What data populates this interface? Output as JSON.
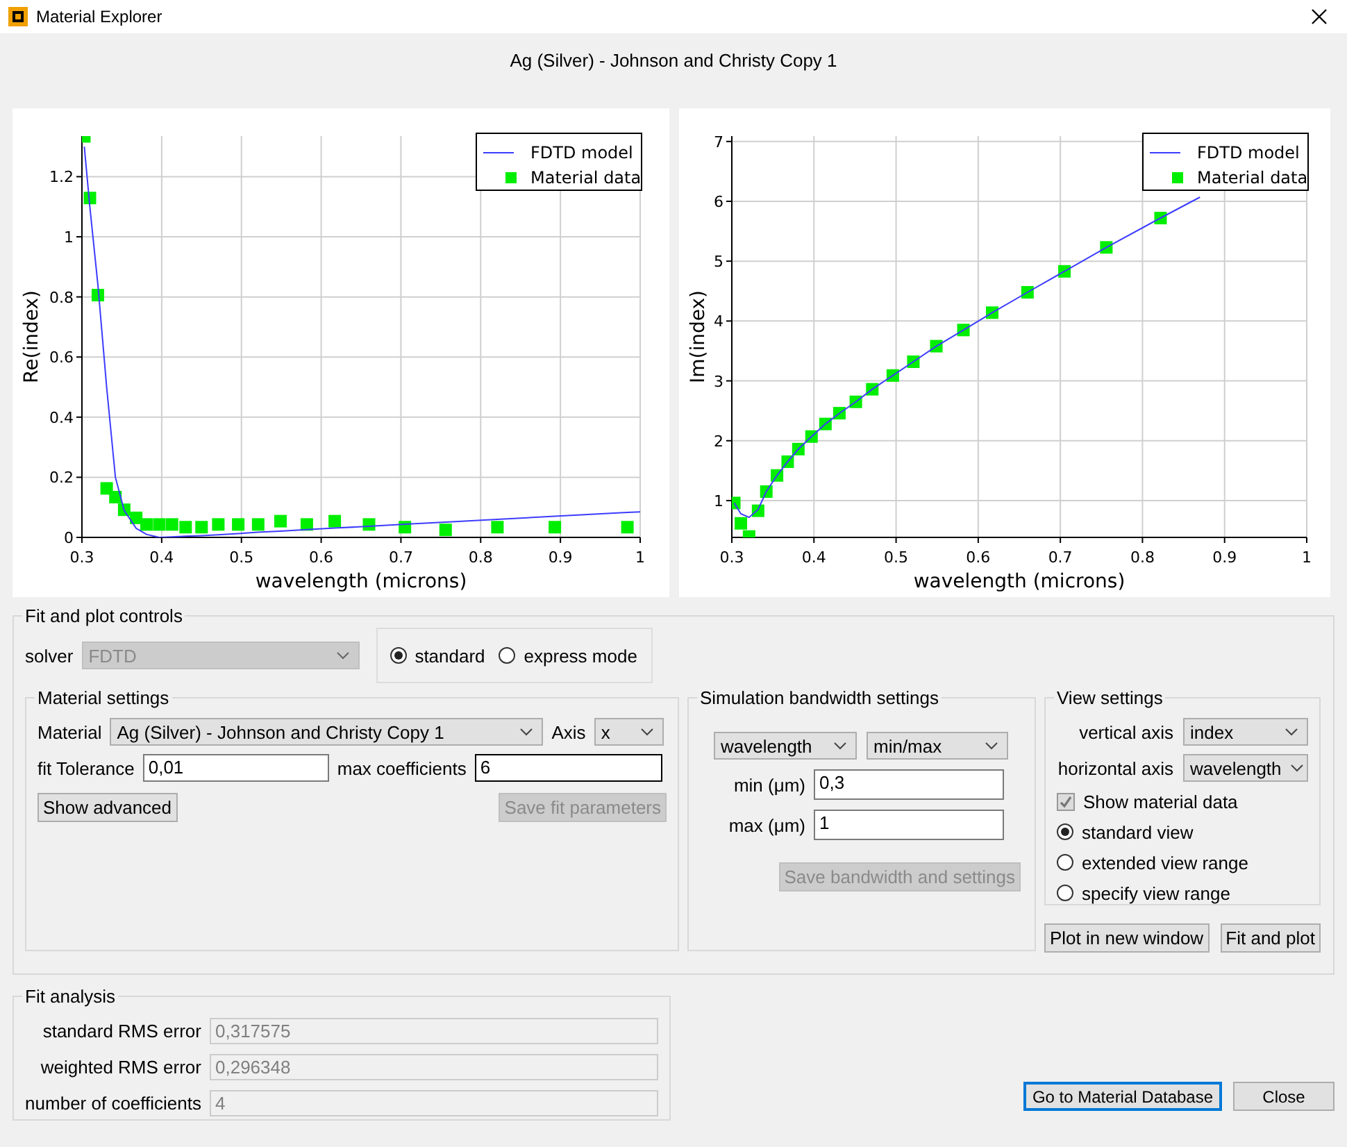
{
  "window": {
    "title": "Material Explorer"
  },
  "heading": "Ag (Silver) - Johnson and Christy Copy 1",
  "plots": [
    {
      "chart_data": {
        "type": "line",
        "xlabel": "wavelength (microns)",
        "ylabel": "Re(index)",
        "x": [
          0.303,
          0.31,
          0.32,
          0.331,
          0.342,
          0.353,
          0.368,
          0.381,
          0.397,
          0.413,
          0.43,
          0.45,
          0.471,
          0.496,
          0.521,
          0.549,
          0.582,
          0.617,
          0.66,
          0.705,
          0.756,
          0.821,
          0.893,
          0.984,
          1
        ],
        "xlim": [
          0.3,
          1
        ],
        "ylim": [
          0,
          1.335
        ],
        "grid": true,
        "legend": "upper right",
        "xticks": [
          0.3,
          0.4,
          0.5,
          0.6,
          0.7,
          0.8,
          0.9,
          1
        ],
        "yticks": [
          0,
          0.2,
          0.4,
          0.6,
          0.8,
          1,
          1.2
        ],
        "series": [
          {
            "name": "FDTD model",
            "type": "line",
            "color": "#3c3cff",
            "values": [
              1.3,
              1.1,
              0.84,
              0.5,
              0.2,
              0.09,
              0.03,
              0.01,
              0,
              0.002,
              0.004,
              0.006,
              0.009,
              0.013,
              0.017,
              0.021,
              0.026,
              0.031,
              0.037,
              0.044,
              0.051,
              0.06,
              0.07,
              0.083,
              0.085
            ]
          },
          {
            "name": "Material data",
            "type": "scatter",
            "marker": "square",
            "color": "#00ee00",
            "values": [
              1.334,
              1.129,
              0.806,
              0.163,
              0.134,
              0.092,
              0.065,
              0.043,
              0.043,
              0.043,
              0.034,
              0.034,
              0.043,
              0.043,
              0.043,
              0.054,
              0.043,
              0.054,
              0.043,
              0.034,
              0.025,
              0.034,
              0.034,
              0.034,
              null
            ]
          }
        ]
      }
    },
    {
      "chart_data": {
        "type": "line",
        "xlabel": "wavelength (microns)",
        "ylabel": "Im(index)",
        "x": [
          0.303,
          0.311,
          0.321,
          0.332,
          0.342,
          0.355,
          0.368,
          0.381,
          0.397,
          0.414,
          0.431,
          0.451,
          0.471,
          0.496,
          0.521,
          0.549,
          0.582,
          0.617,
          0.66,
          0.705,
          0.756,
          0.822,
          0.87
        ],
        "xlim": [
          0.3,
          1
        ],
        "ylim": [
          0.385,
          7.09
        ],
        "grid": true,
        "legend": "upper right",
        "xticks": [
          0.3,
          0.4,
          0.5,
          0.6,
          0.7,
          0.8,
          0.9,
          1
        ],
        "yticks": [
          1,
          2,
          3,
          4,
          5,
          6,
          7
        ],
        "series": [
          {
            "name": "FDTD model",
            "type": "line",
            "color": "#3c3cff",
            "values": [
              0.96,
              0.78,
              0.72,
              0.85,
              1.15,
              1.42,
              1.65,
              1.86,
              2.07,
              2.28,
              2.46,
              2.65,
              2.86,
              3.09,
              3.32,
              3.58,
              3.85,
              4.14,
              4.48,
              4.83,
              5.23,
              5.72,
              6.07
            ]
          },
          {
            "name": "Material data",
            "type": "scatter",
            "marker": "square",
            "color": "#00ee00",
            "values": [
              0.96,
              0.62,
              0.4,
              0.83,
              1.15,
              1.42,
              1.65,
              1.86,
              2.07,
              2.28,
              2.46,
              2.65,
              2.86,
              3.09,
              3.32,
              3.58,
              3.85,
              4.14,
              4.48,
              4.83,
              5.23,
              5.72,
              null
            ]
          }
        ]
      }
    }
  ],
  "fit_controls": {
    "title": "Fit and plot controls",
    "solver": {
      "label": "solver",
      "value": "FDTD",
      "disabled": true
    },
    "modes": [
      {
        "label": "standard",
        "selected": true
      },
      {
        "label": "express mode",
        "selected": false
      }
    ],
    "material_settings": {
      "title": "Material settings",
      "material_label": "Material",
      "material": "Ag (Silver) - Johnson and Christy Copy 1",
      "axis_label": "Axis",
      "axis": "x",
      "fields": [
        {
          "label": "fit Tolerance",
          "value": "0,01",
          "focused": false
        },
        {
          "label": "max coefficients",
          "value": "6",
          "focused": true
        }
      ],
      "buttons": [
        {
          "label": "Show advanced",
          "disabled": false
        },
        {
          "label": "Save fit parameters",
          "disabled": true
        }
      ]
    },
    "bandwidth": {
      "title": "Simulation bandwidth settings",
      "quantity": "wavelength",
      "range_mode": "min/max",
      "fields": [
        {
          "label": "min (μm)",
          "value": "0,3"
        },
        {
          "label": "max (μm)",
          "value": "1"
        }
      ],
      "save_button": {
        "label": "Save bandwidth and settings",
        "disabled": true
      }
    },
    "view": {
      "title": "View settings",
      "selects": [
        {
          "label": "vertical axis",
          "value": "index"
        },
        {
          "label": "horizontal axis",
          "value": "wavelength"
        }
      ],
      "show_data": {
        "label": "Show material data",
        "checked": true
      },
      "ranges": [
        {
          "label": "standard view",
          "selected": true
        },
        {
          "label": "extended view range",
          "selected": false
        },
        {
          "label": "specify view range",
          "selected": false
        }
      ]
    },
    "plot_buttons": [
      "Plot in new window",
      "Fit and plot"
    ]
  },
  "fit_analysis": {
    "title": "Fit analysis",
    "rows": [
      {
        "label": "standard RMS error",
        "value": "0,317575",
        "disabled": true
      },
      {
        "label": "weighted RMS error",
        "value": "0,296348",
        "disabled": true
      },
      {
        "label": "number of coefficients",
        "value": "4",
        "disabled": true
      }
    ]
  },
  "buttons": [
    {
      "label": "Go to Material Database",
      "focused": true
    },
    {
      "label": "Close",
      "focused": false
    }
  ]
}
